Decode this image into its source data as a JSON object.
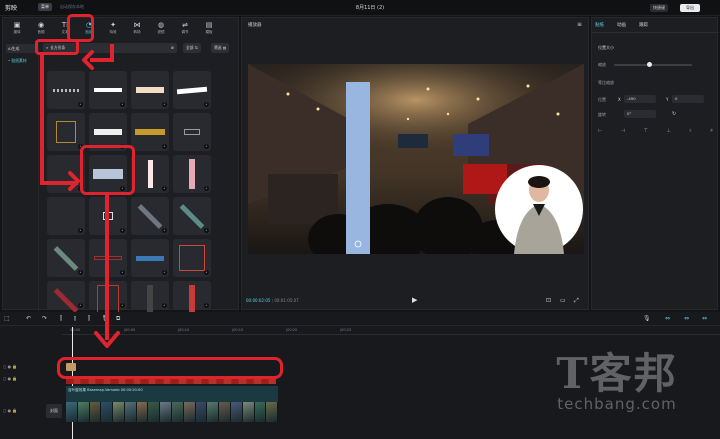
{
  "app": {
    "name": "剪映",
    "menu_label": "菜单",
    "autosave": "自动保存本地",
    "doc_title": "8月11日 (2)",
    "export_label": "导出",
    "shortcut_label": "快捷键"
  },
  "toolbar": [
    {
      "label": "媒体",
      "icon": "media-icon"
    },
    {
      "label": "音频",
      "icon": "audio-icon"
    },
    {
      "label": "文本",
      "icon": "text-icon"
    },
    {
      "label": "贴纸",
      "icon": "sticker-icon",
      "active": true
    },
    {
      "label": "特效",
      "icon": "effects-icon"
    },
    {
      "label": "转场",
      "icon": "transition-icon"
    },
    {
      "label": "滤镜",
      "icon": "filter-icon"
    },
    {
      "label": "调节",
      "icon": "adjust-icon"
    },
    {
      "label": "模板",
      "icon": "template-icon"
    }
  ],
  "sidebar": {
    "items": [
      "AI生成",
      "• 贴纸素材"
    ]
  },
  "search": {
    "value": "长方形条"
  },
  "filters": {
    "all_label": "全部",
    "popular_label": "筛选"
  },
  "player": {
    "title": "播放器",
    "current_time": "00:00:02:05",
    "total_time": "00:01:05:07"
  },
  "right_panel": {
    "tabs": [
      "贴纸",
      "动画",
      "跟踪"
    ],
    "position_size_label": "位置大小",
    "scale_label": "缩放",
    "position_label": "位置",
    "x_label": "X",
    "x_value": "-490",
    "y_label": "Y",
    "y_value": "0",
    "rotate_label": "旋转",
    "rotate_value": "0°",
    "uniform_label": "等比缩放"
  },
  "timeline": {
    "ticks": [
      "00:00",
      "|00:05",
      "|00:10",
      "|00:15",
      "|00:20",
      "|00:25"
    ],
    "clip_title": "百叶窗效果 Basemap.Vamado  00:00:20:00",
    "cover_label": "封面"
  },
  "watermark": {
    "main": "T客邦",
    "sub": "techbang.com"
  }
}
